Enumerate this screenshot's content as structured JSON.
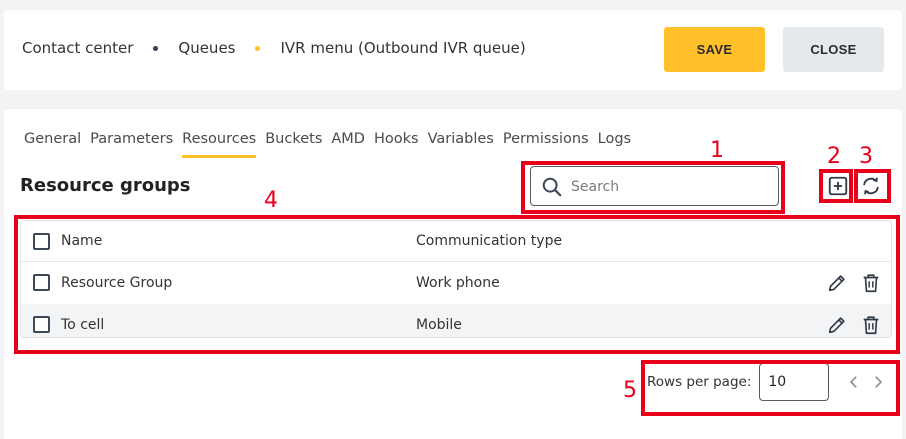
{
  "breadcrumb": {
    "items": [
      "Contact center",
      "Queues",
      "IVR menu (Outbound IVR queue)"
    ],
    "dot_colors": [
      "#2f3e55",
      "#ffc02a"
    ]
  },
  "actions": {
    "save_label": "SAVE",
    "close_label": "CLOSE"
  },
  "tabs": [
    {
      "label": "General"
    },
    {
      "label": "Parameters"
    },
    {
      "label": "Resources",
      "active": true
    },
    {
      "label": "Buckets"
    },
    {
      "label": "AMD"
    },
    {
      "label": "Hooks"
    },
    {
      "label": "Variables"
    },
    {
      "label": "Permissions"
    },
    {
      "label": "Logs"
    }
  ],
  "section": {
    "title": "Resource groups"
  },
  "search": {
    "placeholder": "Search",
    "value": ""
  },
  "toolbar": {
    "add_icon": "add-box-icon",
    "refresh_icon": "refresh-icon"
  },
  "table": {
    "columns": [
      "Name",
      "Communication type"
    ],
    "rows": [
      {
        "name": "Resource Group",
        "type": "Work phone"
      },
      {
        "name": "To cell",
        "type": "Mobile"
      }
    ]
  },
  "pagination": {
    "label": "Rows per page:",
    "value": "10"
  },
  "annotations": [
    "1",
    "2",
    "3",
    "4",
    "5"
  ],
  "colors": {
    "accent": "#ffc02a",
    "annotation": "#e8001a"
  }
}
